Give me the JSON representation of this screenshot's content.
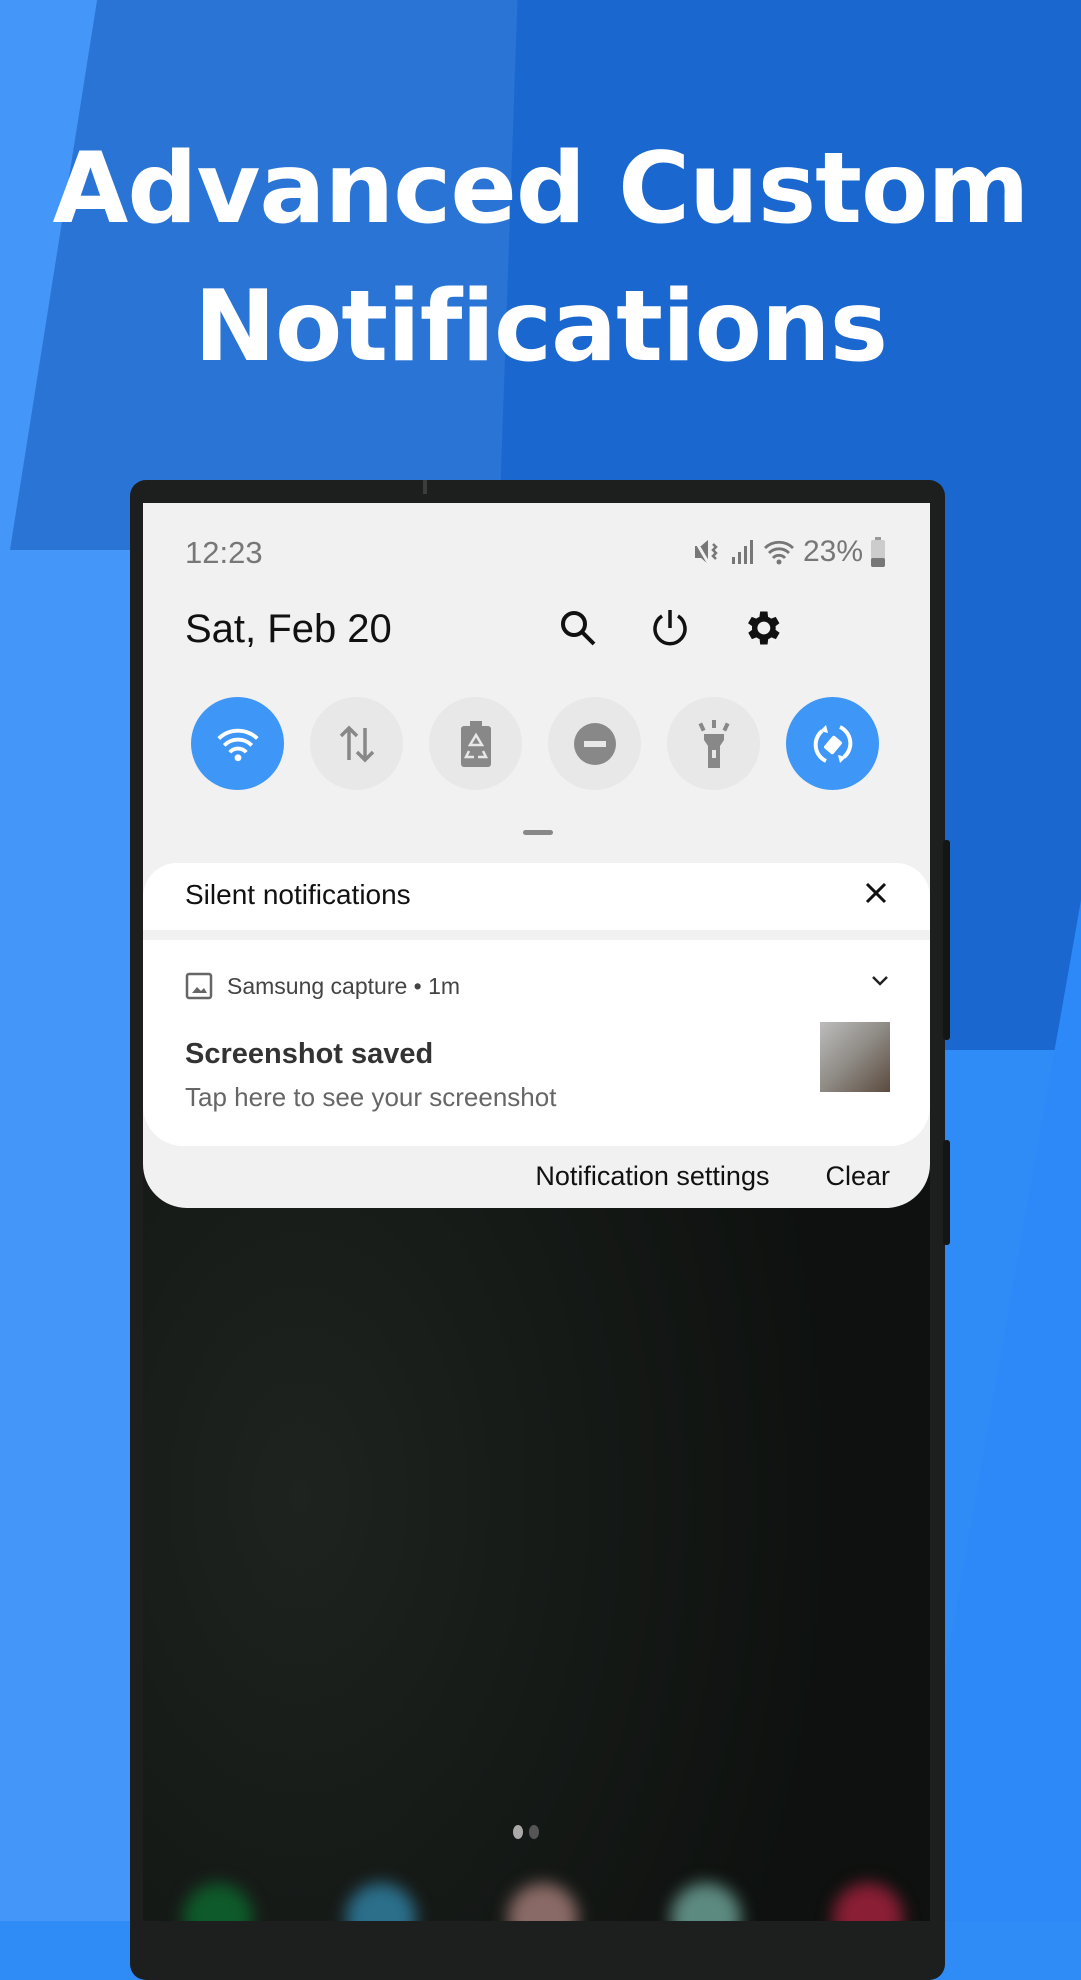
{
  "headline": {
    "line1": "Advanced Custom",
    "line2": "Notifications"
  },
  "status_bar": {
    "time": "12:23",
    "battery": "23%",
    "icons": [
      "mute-vibrate-icon",
      "signal-icon",
      "wifi-icon",
      "battery-icon"
    ]
  },
  "header": {
    "date": "Sat, Feb 20",
    "icons": [
      "search-icon",
      "power-icon",
      "gear-icon"
    ]
  },
  "quick_toggles": [
    {
      "name": "wifi",
      "icon": "wifi-icon",
      "active": true
    },
    {
      "name": "mobile-data",
      "icon": "data-arrows-icon",
      "active": false
    },
    {
      "name": "power-saving",
      "icon": "battery-recycle-icon",
      "active": false
    },
    {
      "name": "do-not-disturb",
      "icon": "minus-circle-icon",
      "active": false
    },
    {
      "name": "flashlight",
      "icon": "flashlight-icon",
      "active": false
    },
    {
      "name": "auto-rotate",
      "icon": "rotate-icon",
      "active": true
    }
  ],
  "colors": {
    "accent": "#3e97f7",
    "panel": "#f1f1f1",
    "background": "#2f8cf7"
  },
  "silent_section": {
    "label": "Silent notifications"
  },
  "notification": {
    "app": "Samsung capture • 1m",
    "title": "Screenshot saved",
    "body": "Tap here to see your screenshot"
  },
  "actions": {
    "settings": "Notification settings",
    "clear": "Clear"
  }
}
